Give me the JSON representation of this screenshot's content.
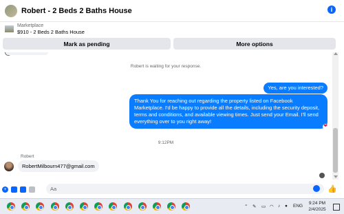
{
  "header": {
    "title": "Robert - 2 Beds 2 Baths House"
  },
  "marketplace": {
    "label": "Marketplace",
    "listing": "$910 - 2 Beds 2 Baths House"
  },
  "actions": {
    "pending": "Mark as pending",
    "more": "More options"
  },
  "chat": {
    "waiting": "Robert is waiting for your response.",
    "msg_out_1": "Yes, are you interested?",
    "msg_out_2": "Thank You for reaching out regarding the property listed on Facebook Marketplace. I'd be happy to provide all the details, including the security deposit, terms and conditions, and available viewing times. Just send your Email. I'll send everything over to you right away!",
    "time": "9:12PM",
    "sender": "Robert",
    "msg_in": "RobertMilbourn477@gmail.com"
  },
  "composer": {
    "placeholder": "Aa"
  },
  "taskbar": {
    "lang": "ENG",
    "time": "9:24 PM",
    "date": "2/4/2025",
    "browser_count": 13
  },
  "colors": {
    "accent": "#0866ff",
    "bubble_out": "#0a7cff",
    "bubble_in": "#f0f2f5"
  }
}
